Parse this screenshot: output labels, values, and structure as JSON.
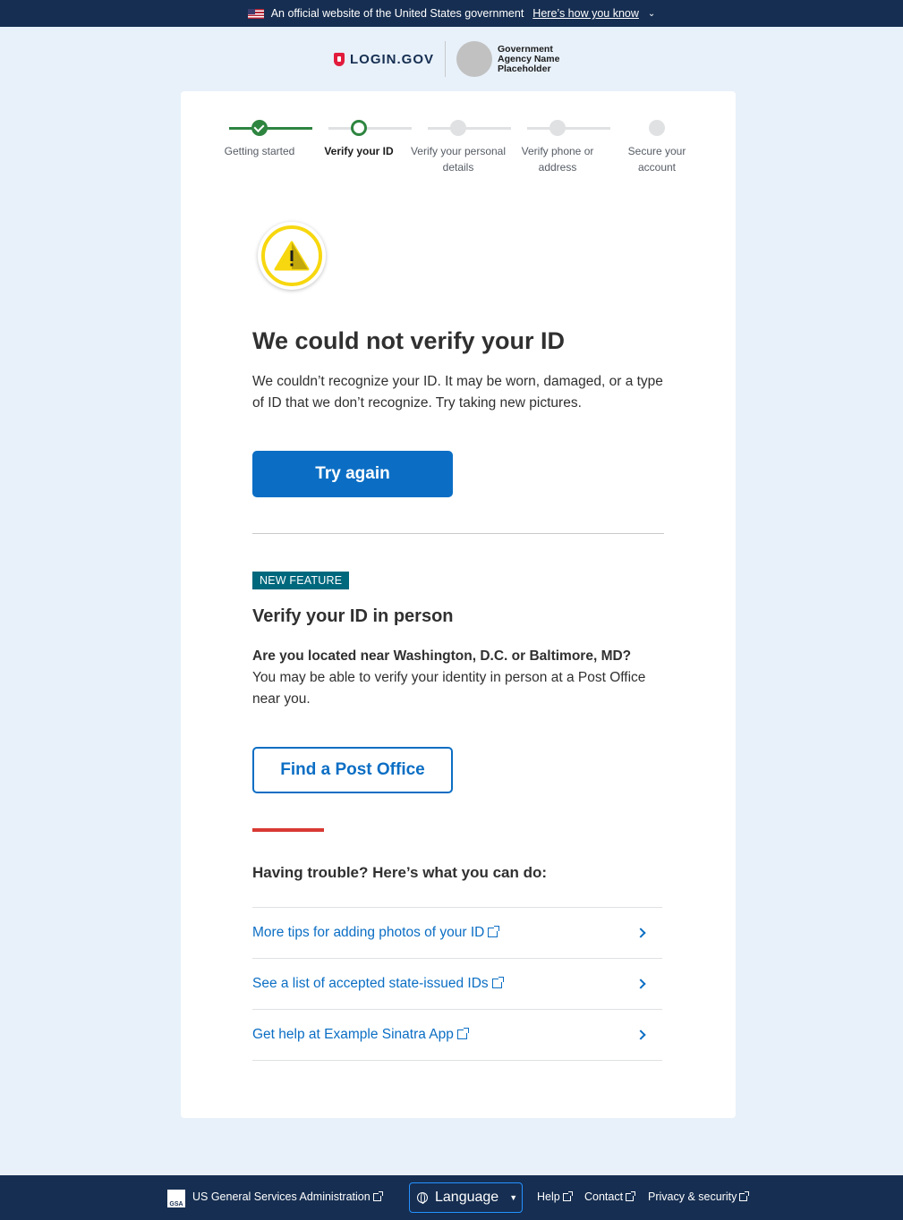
{
  "banner": {
    "text": "An official website of the United States government",
    "link": "Here’s how you know"
  },
  "header": {
    "logo_text": "LOGIN.GOV",
    "agency_name": "Government Agency Name Placeholder"
  },
  "steps": [
    {
      "label": "Getting started",
      "status": "complete"
    },
    {
      "label": "Verify your ID",
      "status": "current"
    },
    {
      "label": "Verify your personal details",
      "status": "pending"
    },
    {
      "label": "Verify phone or address",
      "status": "pending"
    },
    {
      "label": "Secure your account",
      "status": "pending"
    }
  ],
  "main": {
    "heading": "We could not verify your ID",
    "message": "We couldn’t recognize your ID. It may be worn, damaged, or a type of ID that we don’t recognize. Try taking new pictures.",
    "try_again_label": "Try again"
  },
  "in_person": {
    "tag": "NEW FEATURE",
    "heading": "Verify your ID in person",
    "question": "Are you located near Washington, D.C. or Baltimore, MD?",
    "description": "You may be able to verify your identity in person at a Post Office near you.",
    "button_label": "Find a Post Office"
  },
  "trouble": {
    "heading": "Having trouble? Here’s what you can do:",
    "links": [
      "More tips for adding photos of your ID",
      "See a list of accepted state-issued IDs",
      "Get help at Example Sinatra App"
    ]
  },
  "footer": {
    "gsa_logo_text": "GSA",
    "agency": "US General Services Administration",
    "language_label": "Language",
    "help": "Help",
    "contact": "Contact",
    "privacy": "Privacy & security"
  },
  "colors": {
    "primary": "#0b6ec4",
    "success": "#2e8540",
    "warning": "#f7d70f",
    "navy": "#162e51",
    "tag": "#00687d",
    "accent_red": "#d83933"
  }
}
